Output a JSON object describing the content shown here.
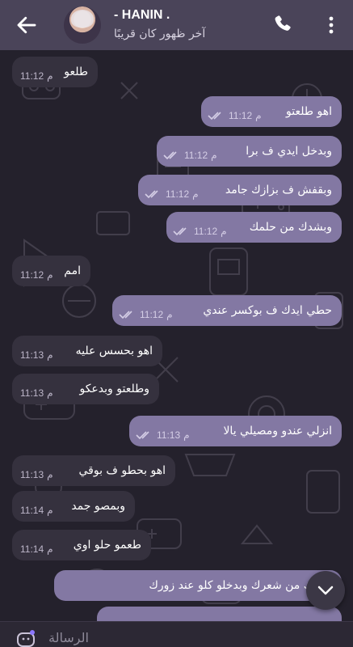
{
  "header": {
    "title": "- HANIN .",
    "status": "آخر ظهور كان قريبًا"
  },
  "messages": [
    {
      "dir": "in",
      "text": "طلعو",
      "time": "11:12",
      "ampm": "م"
    },
    {
      "dir": "out",
      "text": "اهو طلعتو",
      "time": "11:12",
      "ampm": "م"
    },
    {
      "dir": "out",
      "text": "وبدخل ايدي ف برا",
      "time": "11:12",
      "ampm": "م"
    },
    {
      "dir": "out",
      "text": "وبقفش ف بزازك جامد",
      "time": "11:12",
      "ampm": "م"
    },
    {
      "dir": "out",
      "text": "وبشدك من حلمك",
      "time": "11:12",
      "ampm": "م"
    },
    {
      "dir": "in",
      "text": "امم",
      "time": "11:12",
      "ampm": "م"
    },
    {
      "dir": "out",
      "text": "حطي ايدك ف بوكسر عندي",
      "time": "11:12",
      "ampm": "م"
    },
    {
      "dir": "in",
      "text": "اهو بحسس عليه",
      "time": "11:13",
      "ampm": "م"
    },
    {
      "dir": "in",
      "text": "وطلعتو وبدعكو",
      "time": "11:13",
      "ampm": "م"
    },
    {
      "dir": "out",
      "text": "انزلي عندو ومصيلي يالا",
      "time": "11:13",
      "ampm": "م"
    },
    {
      "dir": "in",
      "text": "اهو بحطو ف بوقي",
      "time": "11:13",
      "ampm": "م"
    },
    {
      "dir": "in",
      "text": "وبمصو جمد",
      "time": "11:14",
      "ampm": "م"
    },
    {
      "dir": "in",
      "text": "طعمو حلو اوي",
      "time": "11:14",
      "ampm": "م"
    },
    {
      "dir": "out",
      "text": "بشدك من شعرك وبدخلو كلو عند زورك",
      "time": "",
      "ampm": ""
    }
  ],
  "composer": {
    "placeholder": "الرسالة"
  },
  "colors": {
    "header": "#4a4459",
    "incoming": "#35313e",
    "outgoing": "#8378a3",
    "background": "#24212c"
  },
  "icons": {
    "back": "arrow-left-icon",
    "call": "phone-icon",
    "more": "more-vertical-icon",
    "scroll": "chevron-down-icon",
    "emoji": "emoji-icon",
    "read": "double-check-icon"
  }
}
